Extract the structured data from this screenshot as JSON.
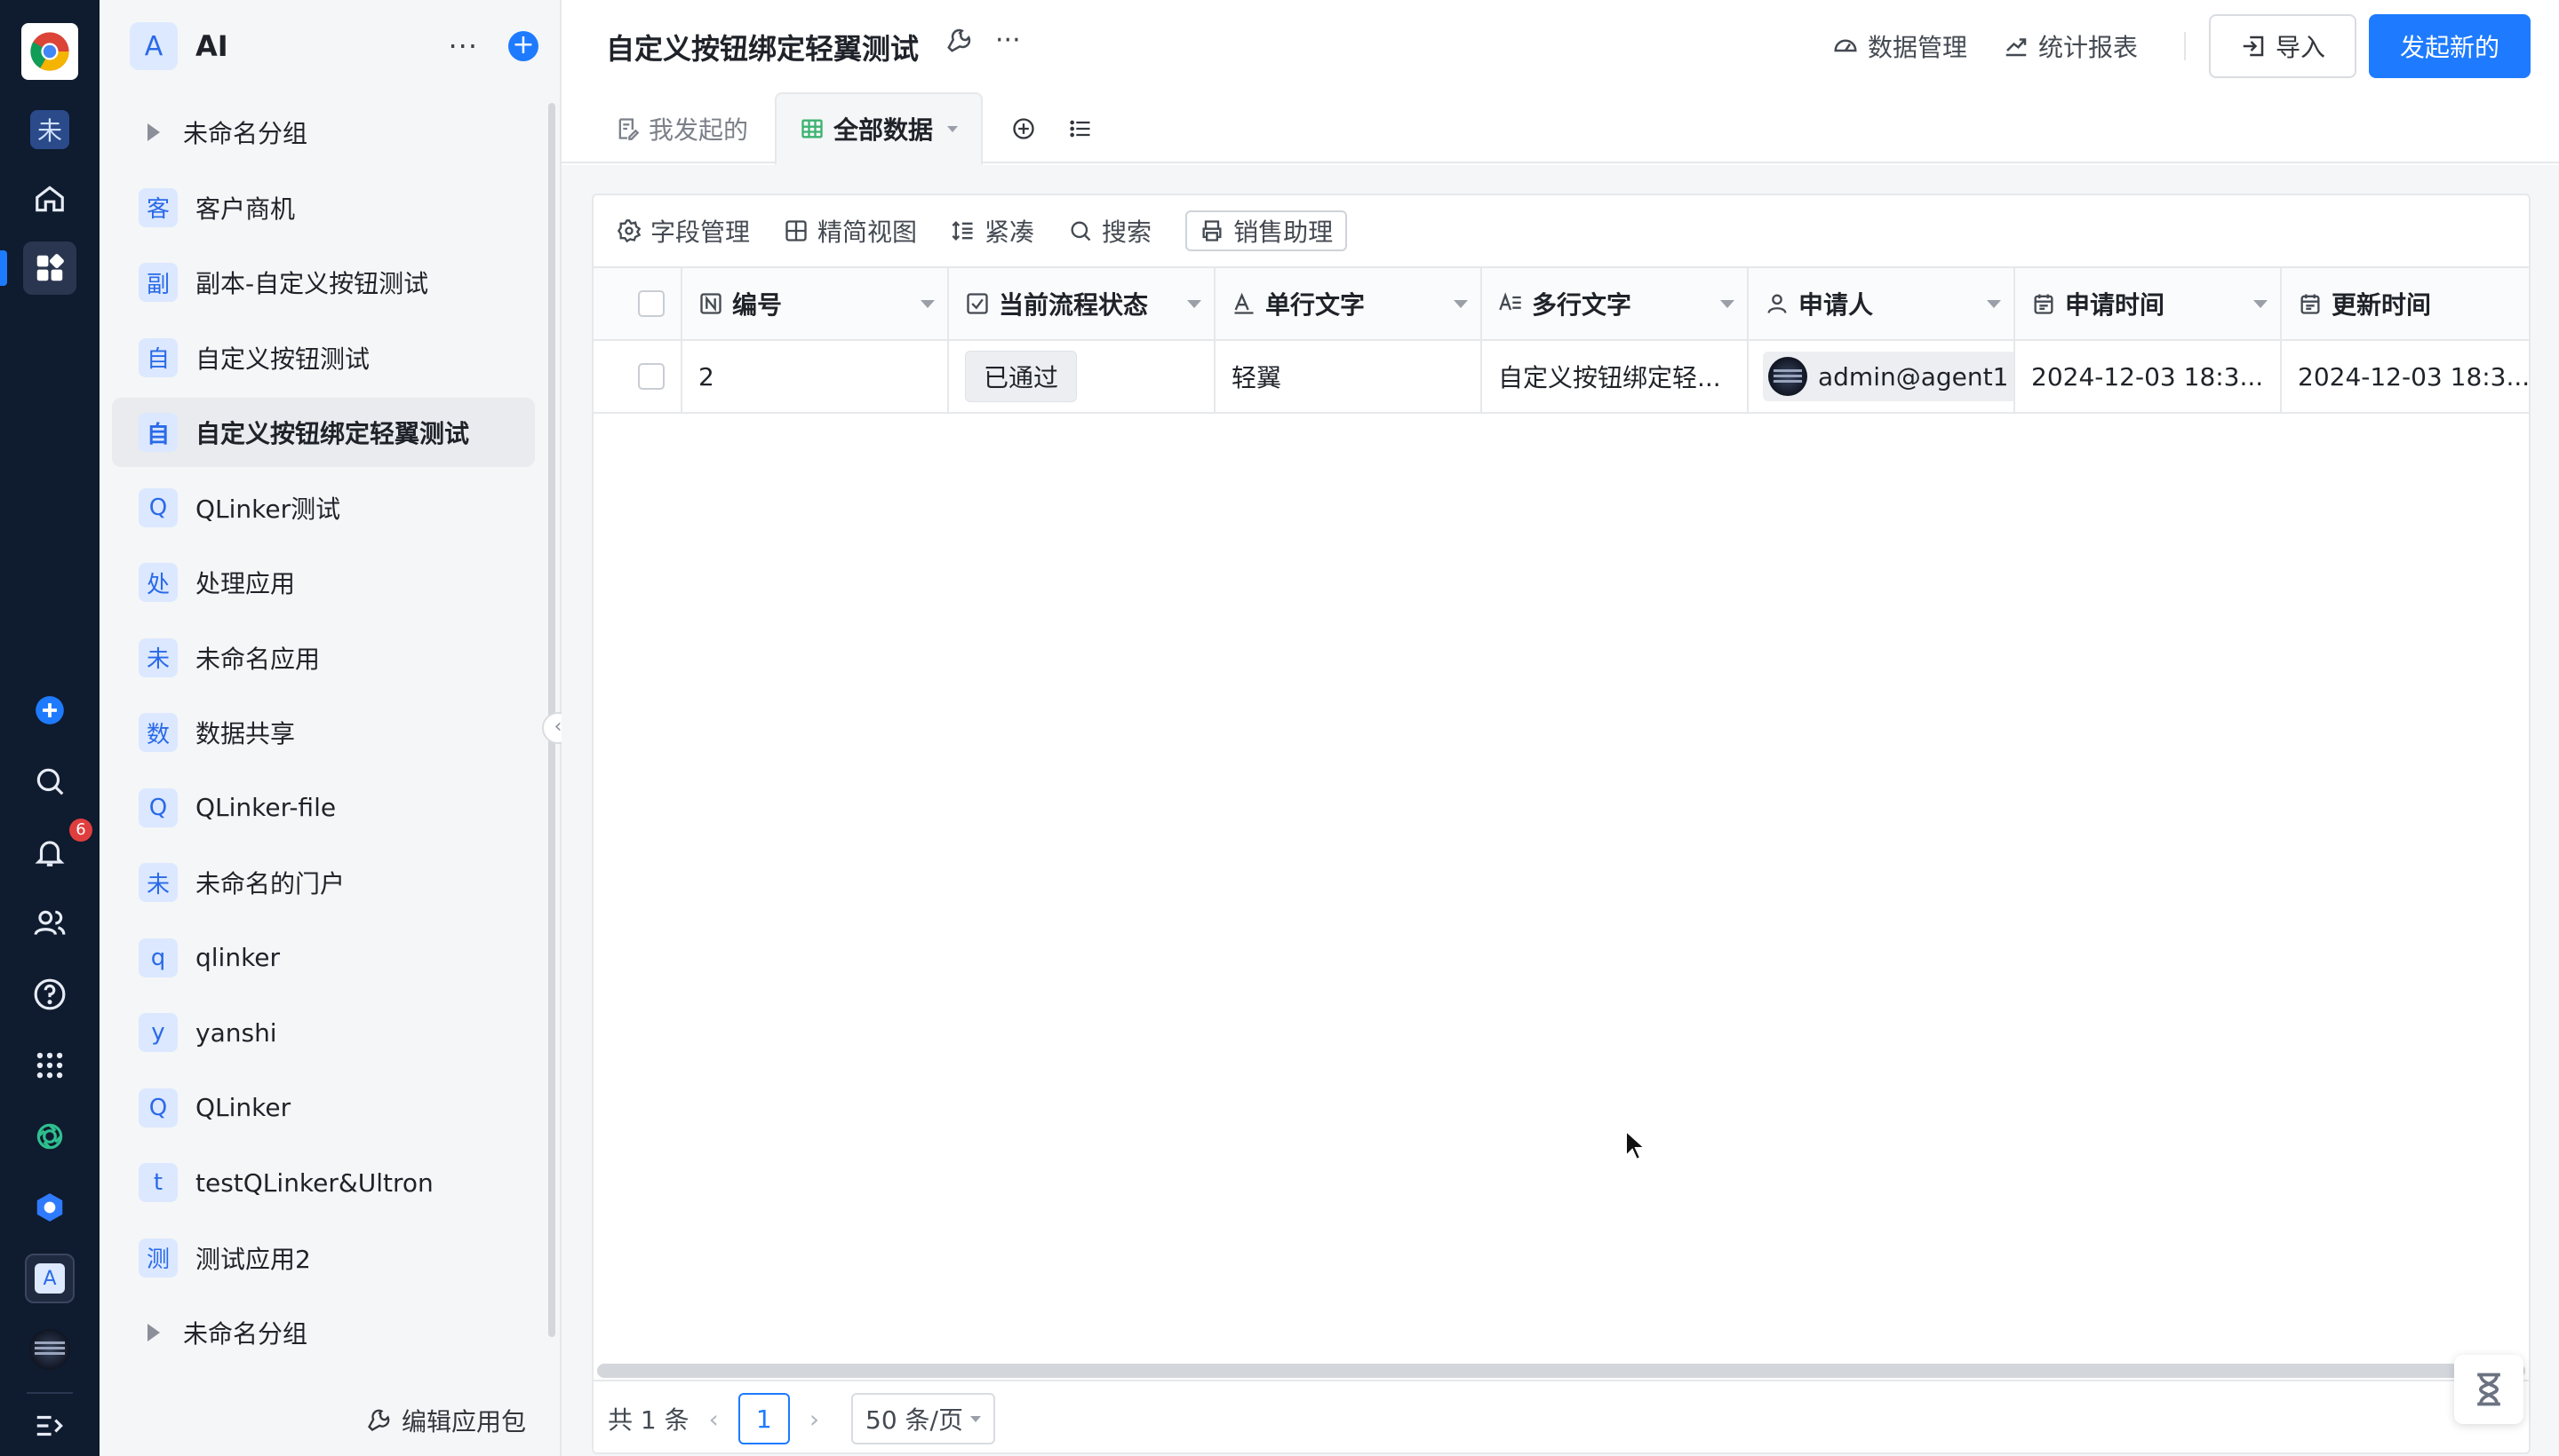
{
  "rail": {
    "items": [
      {
        "name": "unnamed-app-icon",
        "glyph": "未"
      },
      {
        "name": "home-icon"
      },
      {
        "name": "apps-icon",
        "active": true
      },
      {
        "name": "add-icon"
      },
      {
        "name": "search-icon"
      },
      {
        "name": "bell-icon",
        "badge": "6"
      },
      {
        "name": "users-icon"
      },
      {
        "name": "help-icon"
      },
      {
        "name": "grid-icon"
      },
      {
        "name": "openai-icon"
      },
      {
        "name": "hex-icon"
      },
      {
        "name": "letter-a-icon",
        "glyph": "A"
      },
      {
        "name": "avatar"
      },
      {
        "name": "expand-icon"
      }
    ]
  },
  "sidebar": {
    "app_letter": "A",
    "title": "AI",
    "more": "···",
    "items": [
      {
        "type": "group",
        "label": "未命名分组"
      },
      {
        "icon": "客",
        "label": "客户商机"
      },
      {
        "icon": "副",
        "label": "副本-自定义按钮测试"
      },
      {
        "icon": "自",
        "label": "自定义按钮测试"
      },
      {
        "icon": "自",
        "label": "自定义按钮绑定轻翼测试",
        "active": true
      },
      {
        "icon": "Q",
        "label": "QLinker测试"
      },
      {
        "icon": "处",
        "label": "处理应用"
      },
      {
        "icon": "未",
        "label": "未命名应用"
      },
      {
        "icon": "数",
        "label": "数据共享"
      },
      {
        "icon": "Q",
        "label": "QLinker-file"
      },
      {
        "icon": "未",
        "label": "未命名的门户"
      },
      {
        "icon": "q",
        "label": "qlinker"
      },
      {
        "icon": "y",
        "label": "yanshi"
      },
      {
        "icon": "Q",
        "label": "QLinker"
      },
      {
        "icon": "t",
        "label": "testQLinker&Ultron"
      },
      {
        "icon": "测",
        "label": "测试应用2"
      },
      {
        "type": "group",
        "label": "未命名分组"
      }
    ],
    "footer": "编辑应用包"
  },
  "header": {
    "title": "自定义按钮绑定轻翼测试",
    "more": "···",
    "data_manage": "数据管理",
    "report": "统计报表",
    "import": "导入",
    "new": "发起新的"
  },
  "tabs": [
    {
      "label": "我发起的"
    },
    {
      "label": "全部数据",
      "active": true
    }
  ],
  "toolbar": {
    "fields": "字段管理",
    "view": "精简视图",
    "compact": "紧凑",
    "search": "搜索",
    "sales": "销售助理"
  },
  "table": {
    "columns": [
      "编号",
      "当前流程状态",
      "单行文字",
      "多行文字",
      "申请人",
      "申请时间",
      "更新时间"
    ],
    "rows": [
      {
        "no": "2",
        "status": "已通过",
        "single": "轻翼",
        "multi": "自定义按钮绑定轻...",
        "applicant": "admin@agent1",
        "apply_time": "2024-12-03 18:3...",
        "update_time": "2024-12-03 18:3..."
      }
    ]
  },
  "pager": {
    "total": "共 1 条",
    "page": "1",
    "size": "50 条/页"
  },
  "colors": {
    "accent": "#1e7bff",
    "rail_bg": "#0f1b2e",
    "sidebar_bg": "#f5f6f7"
  }
}
